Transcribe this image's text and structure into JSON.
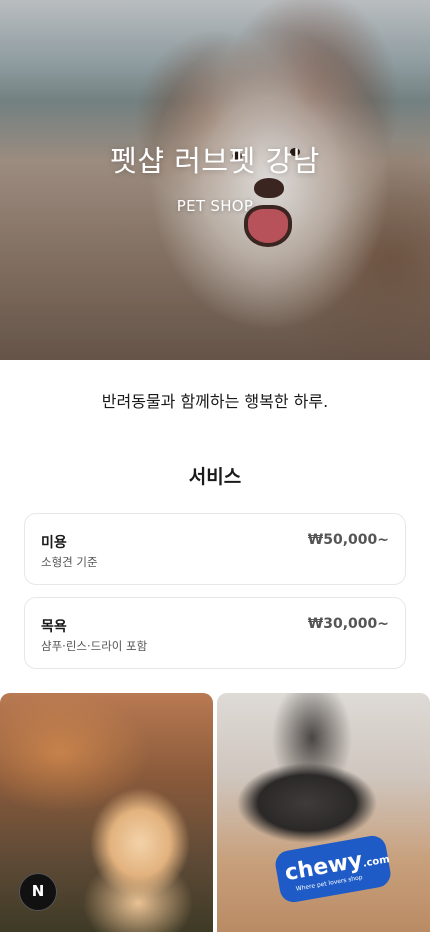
{
  "hero": {
    "title": "펫샵 러브펫 강남",
    "subtitle": "PET SHOP"
  },
  "tagline": "반려동물과 함께하는 행복한 하루.",
  "services": {
    "title": "서비스",
    "items": [
      {
        "name": "미용",
        "desc": "소형견 기준",
        "price": "₩50,000~"
      },
      {
        "name": "목욕",
        "desc": "샴푸·린스·드라이 포함",
        "price": "₩30,000~"
      }
    ]
  },
  "gallery": {
    "photo2_logo": "chewy",
    "photo2_logo_suffix": ".com",
    "photo2_tagline": "Where pet lovers shop"
  },
  "badge": {
    "label": "N"
  }
}
